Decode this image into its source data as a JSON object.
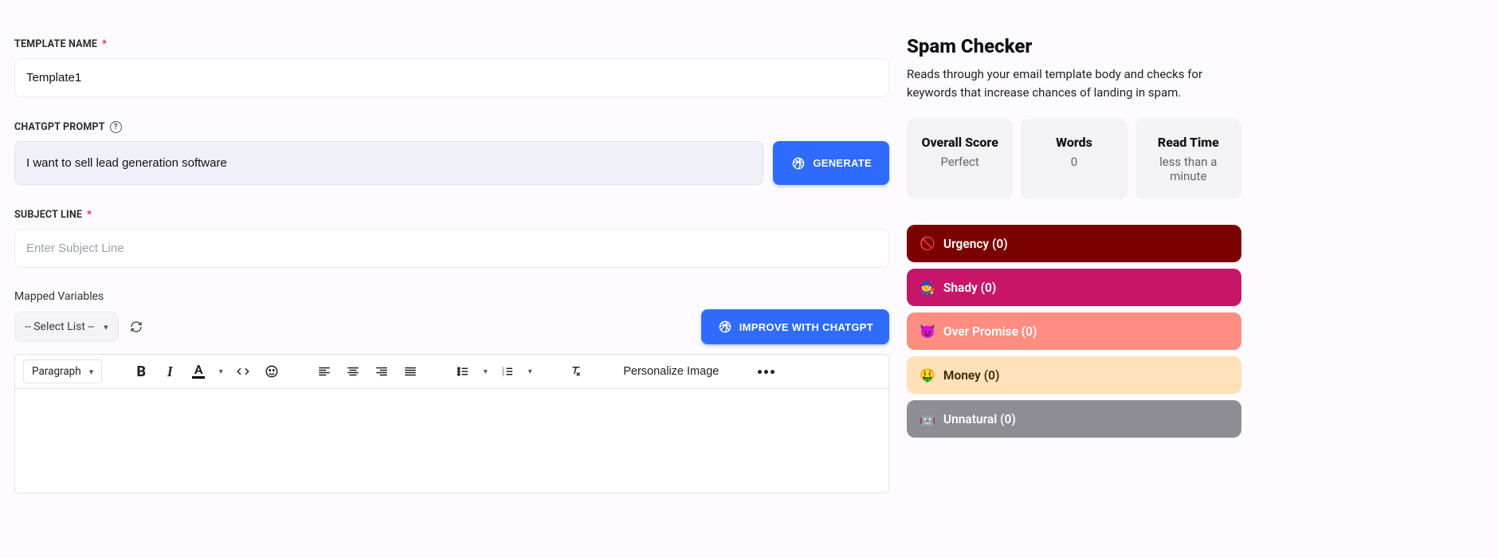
{
  "form": {
    "template_name": {
      "label": "TEMPLATE NAME",
      "value": "Template1"
    },
    "chatgpt_prompt": {
      "label": "CHATGPT PROMPT",
      "value": "I want to sell lead generation software",
      "generate_label": "GENERATE"
    },
    "subject_line": {
      "label": "SUBJECT LINE",
      "placeholder": "Enter Subject Line",
      "value": ""
    },
    "mapped_variables": {
      "label": "Mapped Variables",
      "select_label": "-- Select List --",
      "improve_label": "IMPROVE WITH CHATGPT"
    },
    "toolbar": {
      "format_select": "Paragraph",
      "personalize": "Personalize Image"
    }
  },
  "spam": {
    "title": "Spam Checker",
    "desc": "Reads through your email template body and checks for keywords that increase chances of landing in spam.",
    "stats": {
      "score": {
        "label": "Overall Score",
        "value": "Perfect"
      },
      "words": {
        "label": "Words",
        "value": "0"
      },
      "read": {
        "label": "Read Time",
        "value": "less than a minute"
      }
    },
    "categories": {
      "urgency": {
        "emoji": "🚫",
        "label": "Urgency (0)"
      },
      "shady": {
        "emoji": "🧙",
        "label": "Shady (0)"
      },
      "over": {
        "emoji": "😈",
        "label": "Over Promise (0)"
      },
      "money": {
        "emoji": "🤑",
        "label": "Money (0)"
      },
      "unnat": {
        "emoji": "🤖",
        "label": "Unnatural (0)"
      }
    }
  }
}
